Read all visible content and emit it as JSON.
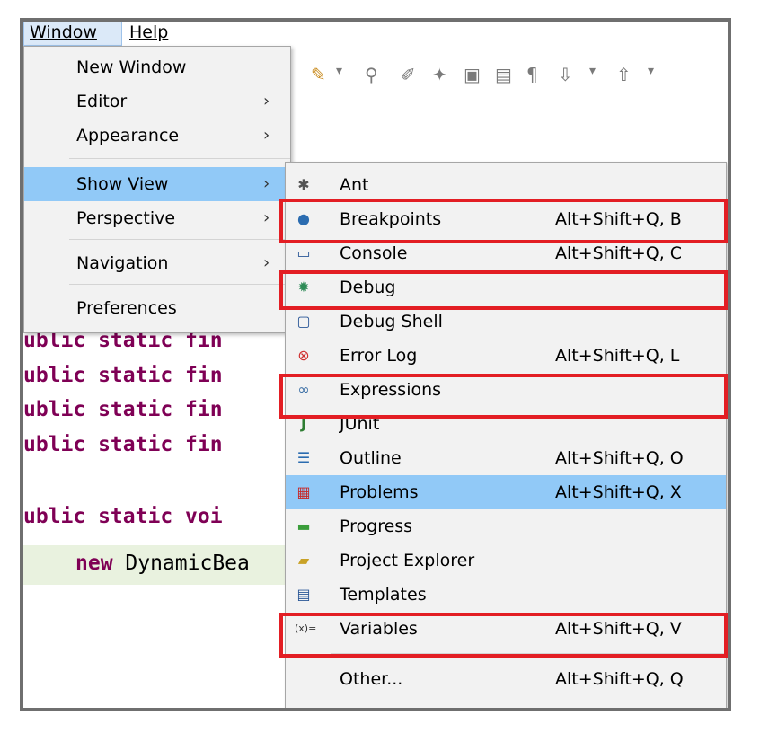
{
  "menubar": {
    "window": "Window",
    "help": "Help"
  },
  "window_menu": {
    "items": [
      {
        "label": "New Window",
        "submenu": false
      },
      {
        "label": "Editor",
        "submenu": true
      },
      {
        "label": "Appearance",
        "submenu": true
      },
      {
        "label": "Show View",
        "submenu": true,
        "active": true
      },
      {
        "label": "Perspective",
        "submenu": true
      },
      {
        "label": "Navigation",
        "submenu": true
      },
      {
        "label": "Preferences",
        "submenu": false
      }
    ],
    "arrow": "›"
  },
  "show_view_menu": {
    "items": [
      {
        "label": "Ant",
        "accel": "",
        "icon": "ant-icon"
      },
      {
        "label": "Breakpoints",
        "accel": "Alt+Shift+Q, B",
        "icon": "breakpoints-icon"
      },
      {
        "label": "Console",
        "accel": "Alt+Shift+Q, C",
        "icon": "console-icon"
      },
      {
        "label": "Debug",
        "accel": "",
        "icon": "debug-icon"
      },
      {
        "label": "Debug Shell",
        "accel": "",
        "icon": "debug-shell-icon"
      },
      {
        "label": "Error Log",
        "accel": "Alt+Shift+Q, L",
        "icon": "error-log-icon"
      },
      {
        "label": "Expressions",
        "accel": "",
        "icon": "expressions-icon"
      },
      {
        "label": "JUnit",
        "accel": "",
        "icon": "junit-icon"
      },
      {
        "label": "Outline",
        "accel": "Alt+Shift+Q, O",
        "icon": "outline-icon"
      },
      {
        "label": "Problems",
        "accel": "Alt+Shift+Q, X",
        "icon": "problems-icon",
        "active": true
      },
      {
        "label": "Progress",
        "accel": "",
        "icon": "progress-icon"
      },
      {
        "label": "Project Explorer",
        "accel": "",
        "icon": "project-explorer-icon"
      },
      {
        "label": "Templates",
        "accel": "",
        "icon": "templates-icon"
      },
      {
        "label": "Variables",
        "accel": "Alt+Shift+Q, V",
        "icon": "variables-icon"
      },
      {
        "label": "Other...",
        "accel": "Alt+Shift+Q, Q",
        "icon": ""
      }
    ]
  },
  "editor": {
    "lines": [
      {
        "keyword": "ublic static fin"
      },
      {
        "keyword": "ublic static fin"
      },
      {
        "keyword": "ublic static fin"
      },
      {
        "keyword": "ublic static fin"
      },
      {
        "keyword": "ublic static voi"
      }
    ],
    "new_line_keyword": "new",
    "new_line_text": " DynamicBea"
  },
  "colors": {
    "highlight": "#91c9f7",
    "redbox": "#e31e24",
    "keyword": "#7f0055"
  }
}
